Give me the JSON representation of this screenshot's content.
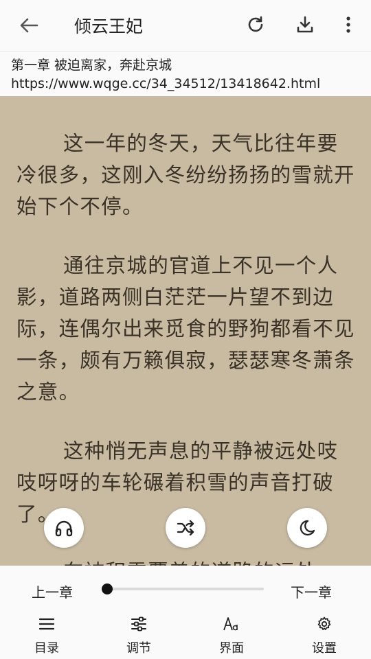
{
  "appbar": {
    "title": "倾云王妃",
    "icons": [
      "back-arrow-icon",
      "refresh-icon",
      "download-icon",
      "more-vert-icon"
    ]
  },
  "info": {
    "chapter": "第一章 被迫离家，奔赴京城",
    "url": "https://www.wqge.cc/34_34512/13418642.html"
  },
  "reader": {
    "paragraphs": [
      "这一年的冬天，天气比往年要冷很多，这刚入冬纷纷扬扬的雪就开始下个不停。",
      "通往京城的官道上不见一个人影，道路两侧白茫茫一片望不到边际，连偶尔出来觅食的野狗都看不见一条，颇有万籁俱寂，瑟瑟寒冬萧条之意。",
      "这种悄无声息的平静被远处吱吱呀呀的车轮碾着积雪的声音打破了。",
      "车被积雪覆盖的道路的远处"
    ],
    "background": "#C8BBA2",
    "text_color": "#3A3226"
  },
  "fabs": [
    "headphones-icon",
    "shuffle-icon",
    "moon-icon"
  ],
  "panel": {
    "prev": "上一章",
    "next": "下一章",
    "progress": 0.0,
    "tabs": [
      {
        "label": "目录",
        "icon": "list-icon"
      },
      {
        "label": "调节",
        "icon": "sliders-icon"
      },
      {
        "label": "界面",
        "icon": "font-size-icon"
      },
      {
        "label": "设置",
        "icon": "gear-icon"
      }
    ]
  }
}
